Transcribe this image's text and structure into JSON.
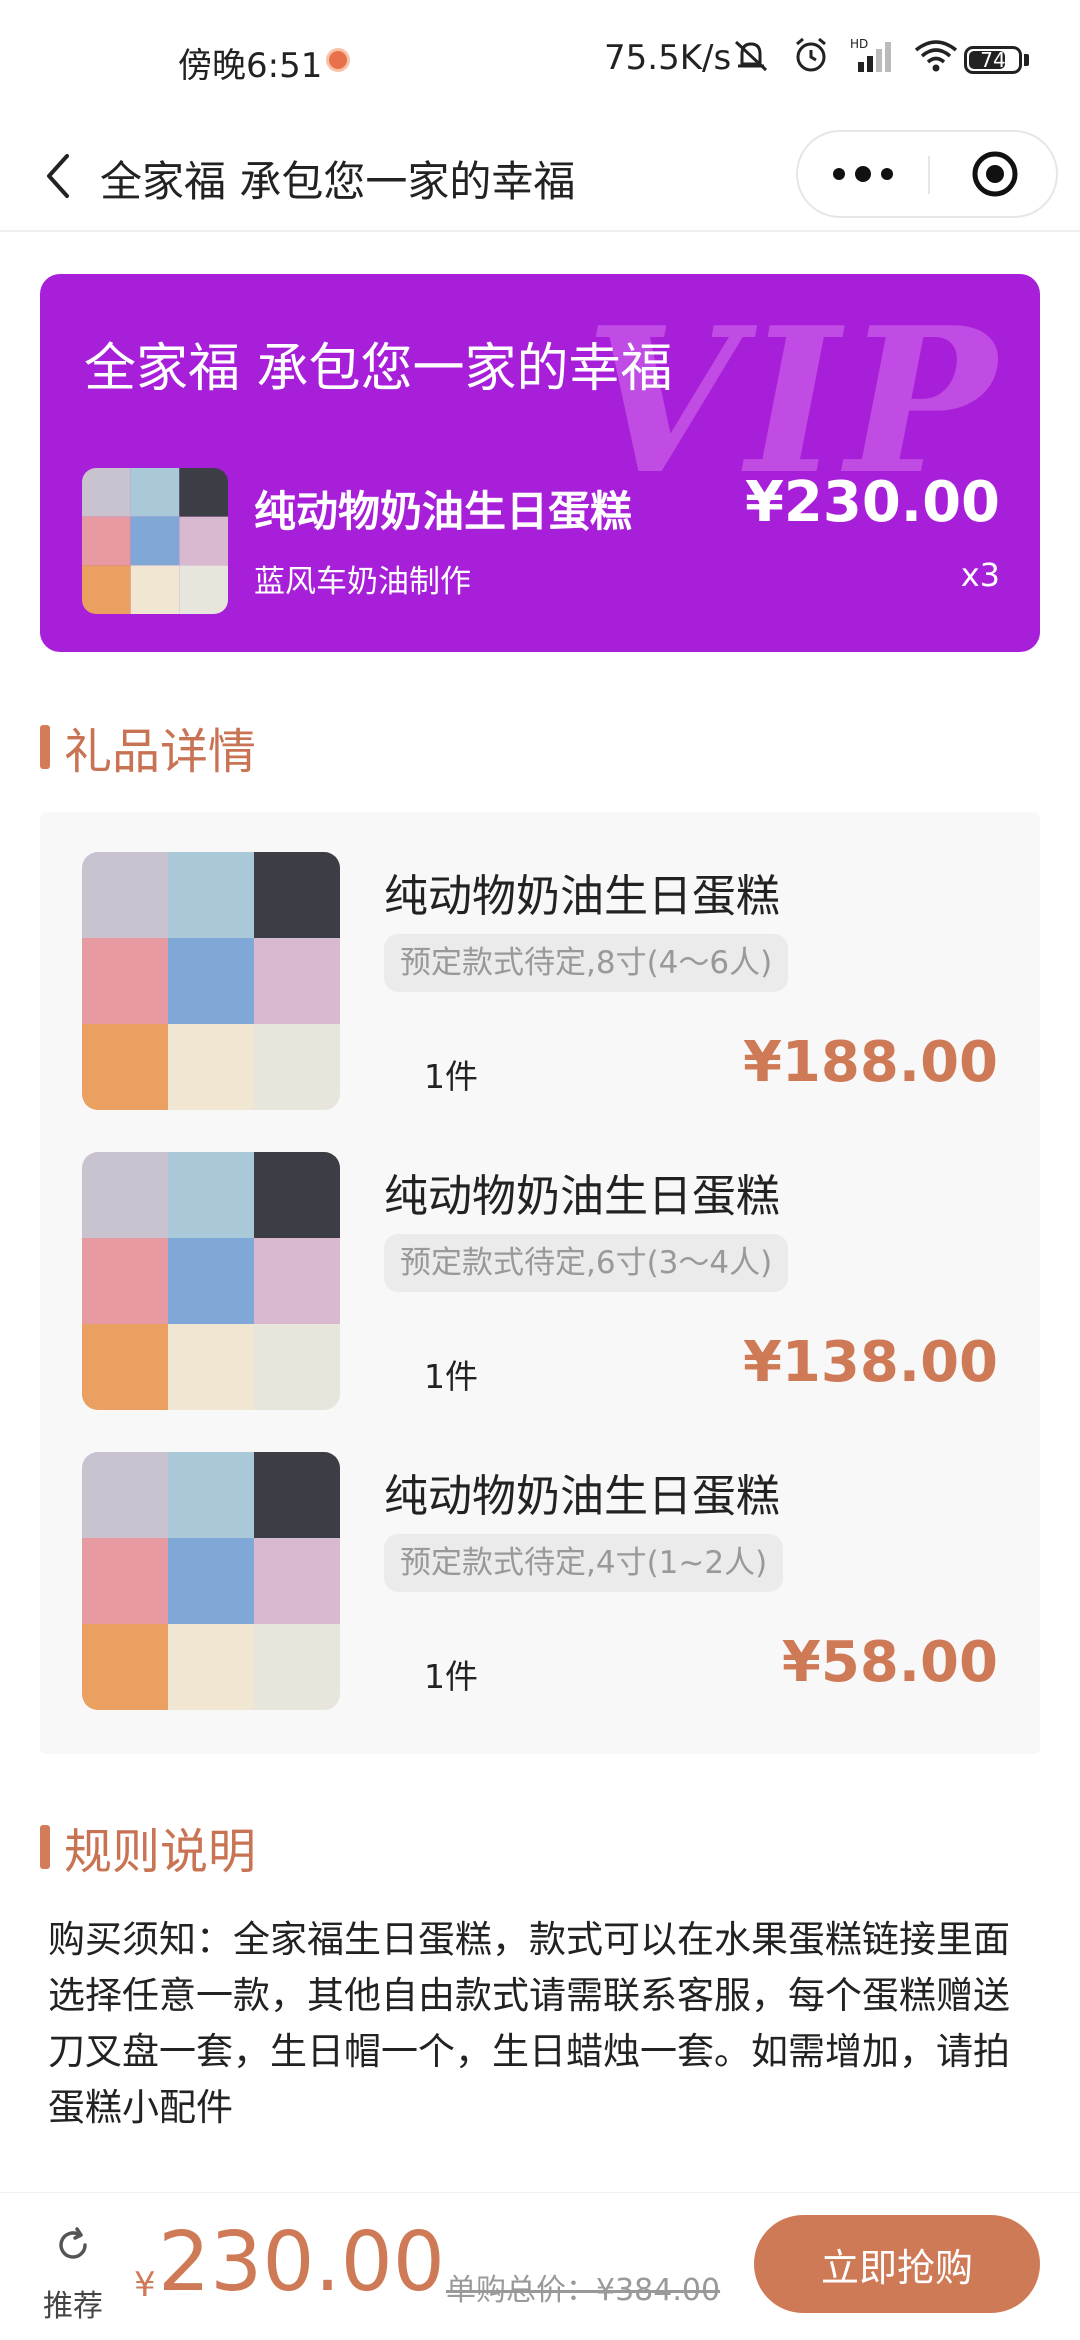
{
  "status_bar": {
    "time": "傍晚6:51",
    "network_speed": "75.5K/s",
    "battery": "74"
  },
  "nav": {
    "title": "全家福 承包您一家的幸福"
  },
  "vip_card": {
    "watermark": "VIP",
    "title": "全家福 承包您一家的幸福",
    "product_name": "纯动物奶油生日蛋糕",
    "product_sub": "蓝风车奶油制作",
    "price": "¥230.00",
    "quantity": "x3",
    "bg_color": "#a81fd9"
  },
  "gift_section": {
    "heading": "礼品详情",
    "items": [
      {
        "name": "纯动物奶油生日蛋糕",
        "spec": "预定款式待定,8寸(4～6人)",
        "qty": "1件",
        "price": "¥188.00"
      },
      {
        "name": "纯动物奶油生日蛋糕",
        "spec": "预定款式待定,6寸(3～4人)",
        "qty": "1件",
        "price": "¥138.00"
      },
      {
        "name": "纯动物奶油生日蛋糕",
        "spec": "预定款式待定,4寸(1~2人)",
        "qty": "1件",
        "price": "¥58.00"
      }
    ]
  },
  "rules_section": {
    "heading": "规则说明",
    "text": "购买须知：全家福生日蛋糕，款式可以在水果蛋糕链接里面选择任意一款，其他自由款式请需联系客服，每个蛋糕赠送刀叉盘一套，生日帽一个，生日蜡烛一套。如需增加，请拍蛋糕小配件"
  },
  "bottom_bar": {
    "recommend_label": "推荐",
    "currency": "¥",
    "price": "230.00",
    "original_price": "单购总价：¥384.00",
    "buy_label": "立即抢购"
  },
  "colors": {
    "accent": "#cf7a56",
    "vip_purple": "#a81fd9",
    "panel_bg": "#f8f8f8"
  },
  "icons": [
    "back-arrow-icon",
    "more-dots-icon",
    "close-target-icon",
    "refresh-icon",
    "wifi-icon",
    "signal-icon",
    "alarm-icon",
    "mute-icon"
  ]
}
